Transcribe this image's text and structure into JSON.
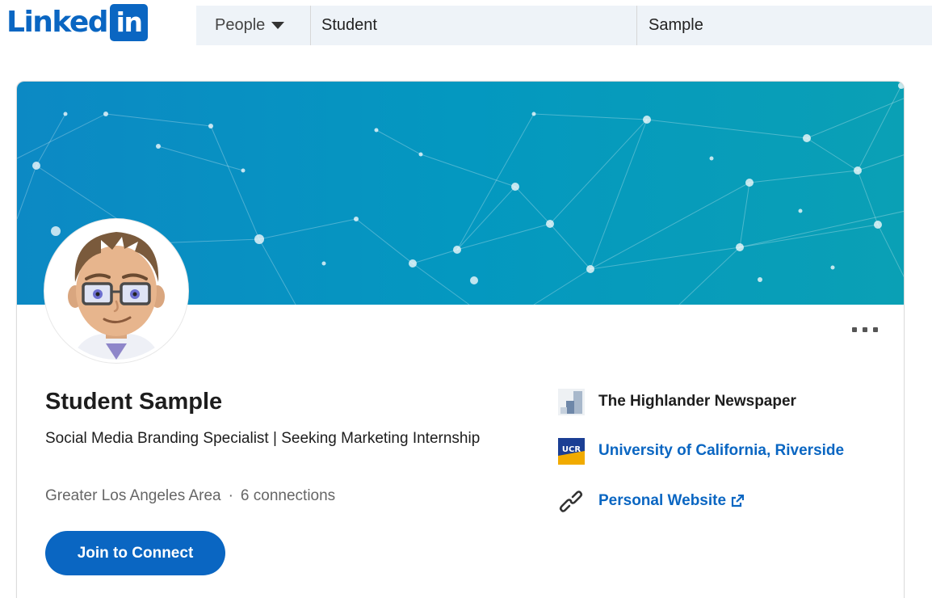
{
  "header": {
    "logo_text": "Linked",
    "logo_box_text": "in",
    "search_filter_label": "People",
    "first_name_value": "Student",
    "last_name_value": "Sample"
  },
  "profile": {
    "name": "Student Sample",
    "headline": "Social Media Branding Specialist | Seeking Marketing Internship",
    "location": "Greater Los Angeles Area",
    "separator": "·",
    "connections": "6 connections",
    "join_button_label": "Join to Connect",
    "more_actions_icon": "ellipsis-icon",
    "avatar_icon": "bitmoji-avatar"
  },
  "sidebar": {
    "company": {
      "label": "The Highlander Newspaper",
      "icon": "company-logo-icon"
    },
    "school": {
      "label": "University of California, Riverside",
      "icon": "ucr-logo-icon",
      "logo_text": "UCR"
    },
    "website": {
      "label": "Personal Website",
      "icon": "link-icon"
    }
  },
  "colors": {
    "brand": "#0a66c2",
    "banner_start": "#0c89c4",
    "banner_end": "#0aa0b5",
    "search_bg": "#eef3f8"
  }
}
